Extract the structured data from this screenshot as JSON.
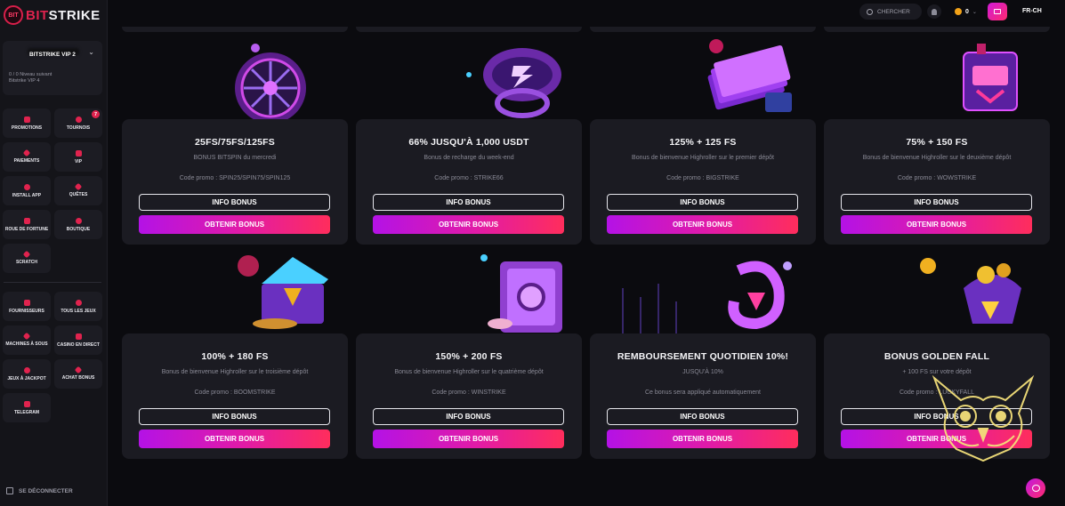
{
  "sidebar": {
    "logo_badge": "BIT",
    "logo_main": "BIT",
    "logo_rest": "STRIKE",
    "vip": {
      "name": "BITSTRIKE VIP 2",
      "level_line1": "0 / 0 Niveau suivant",
      "level_line2": "Bitstrike VIP 4"
    },
    "nav_top": [
      {
        "label": "PROMOTIONS",
        "icon": "gift-icon"
      },
      {
        "label": "TOURNOIS",
        "icon": "trophy-icon",
        "badge": "7"
      },
      {
        "label": "PAIEMENTS",
        "icon": "wallet-icon"
      },
      {
        "label": "VIP",
        "icon": "crown-icon"
      },
      {
        "label": "INSTALL APP",
        "icon": "download-icon"
      },
      {
        "label": "QUÊTES",
        "icon": "target-icon"
      },
      {
        "label": "ROUE DE FORTUNE",
        "icon": "wheel-icon"
      },
      {
        "label": "BOUTIQUE",
        "icon": "tag-icon"
      },
      {
        "label": "SCRATCH",
        "icon": "ticket-icon"
      }
    ],
    "nav_bottom": [
      {
        "label": "FOURNISSEURS",
        "icon": "provider-icon"
      },
      {
        "label": "TOUS LES JEUX",
        "icon": "grid-icon"
      },
      {
        "label": "MACHINES À SOUS",
        "icon": "slot-icon"
      },
      {
        "label": "CASINO EN DIRECT",
        "icon": "live-icon"
      },
      {
        "label": "JEUX À JACKPOT",
        "icon": "jackpot-icon"
      },
      {
        "label": "ACHAT BONUS",
        "icon": "cart-icon"
      },
      {
        "label": "TELEGRAM",
        "icon": "telegram-icon"
      }
    ],
    "logout": "SE DÉCONNECTER"
  },
  "topbar": {
    "search_placeholder": "CHERCHER",
    "balance": "0",
    "language": "FR-CH"
  },
  "colors": {
    "accent": "#e0234e",
    "gradient_start": "#b412e6",
    "gradient_end": "#ff2d5c",
    "card_bg": "#1b1b22",
    "page_bg": "#0b0b0f",
    "coin": "#f2a218"
  },
  "bonuses": [
    {
      "title": "25FS/75FS/125FS",
      "subtitle": "BONUS BITSPIN du mercredi",
      "code": "Code promo : SPIN25/SPIN75/SPIN125",
      "info": "INFO BONUS",
      "cta": "OBTENIR BONUS",
      "art": "wheel"
    },
    {
      "title": "66% JUSQU'À 1,000 USDT",
      "subtitle": "Bonus de recharge du week-end",
      "code": "Code promo : STRIKE66",
      "info": "INFO BONUS",
      "cta": "OBTENIR BONUS",
      "art": "ring"
    },
    {
      "title": "125% + 125 FS",
      "subtitle": "Bonus de bienvenue Highroller sur le premier dépôt",
      "code": "Code promo : BIGSTRIKE",
      "info": "INFO BONUS",
      "cta": "OBTENIR BONUS",
      "art": "cash"
    },
    {
      "title": "75% + 150 FS",
      "subtitle": "Bonus de bienvenue Highroller sur le deuxième dépôt",
      "code": "Code promo : WOWSTRIKE",
      "info": "INFO BONUS",
      "cta": "OBTENIR BONUS",
      "art": "robot"
    },
    {
      "title": "100% + 180 FS",
      "subtitle": "Bonus de bienvenue Highroller sur le troisième dépôt",
      "code": "Code promo : BOOMSTRIKE",
      "info": "INFO BONUS",
      "cta": "OBTENIR BONUS",
      "art": "chest"
    },
    {
      "title": "150% + 200 FS",
      "subtitle": "Bonus de bienvenue Highroller sur le quatrième dépôt",
      "code": "Code promo : WINSTRIKE",
      "info": "INFO BONUS",
      "cta": "OBTENIR BONUS",
      "art": "safe"
    },
    {
      "title": "REMBOURSEMENT QUOTIDIEN 10%!",
      "subtitle": "JUSQU'À 10%",
      "code": "Ce bonus sera appliqué automatiquement",
      "info": "INFO BONUS",
      "cta": "OBTENIR BONUS",
      "art": "cashback"
    },
    {
      "title": "BONUS GOLDEN FALL",
      "subtitle": "+ 100 FS sur votre dépôt",
      "code": "Code promo : LUCKYFALL",
      "info": "INFO BONUS",
      "cta": "OBTENIR BONUS",
      "art": "pot"
    }
  ]
}
